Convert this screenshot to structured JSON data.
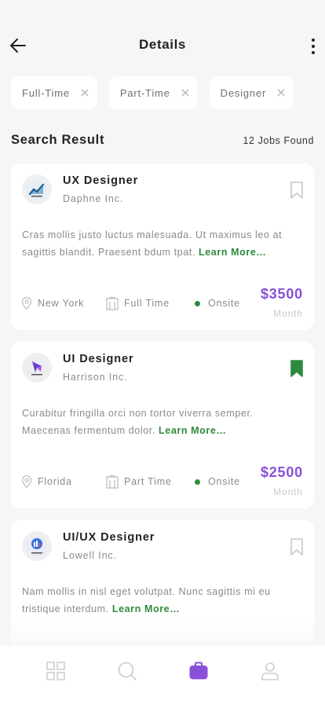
{
  "header": {
    "title": "Details"
  },
  "filters": [
    {
      "label": "Full-Time"
    },
    {
      "label": "Part-Time"
    },
    {
      "label": "Designer"
    }
  ],
  "results": {
    "title": "Search Result",
    "count_text": "12 Jobs Found"
  },
  "jobs": [
    {
      "title": "UX Designer",
      "company": "Daphne Inc.",
      "description": "Cras mollis justo luctus malesuada. Ut maximus leo at sagittis blandit. Praesent bdum tpat.",
      "learn_more": "Learn More…",
      "location": "New York",
      "type": "Full Time",
      "mode": "Onsite",
      "price": "$3500",
      "period": "Month",
      "bookmarked": false
    },
    {
      "title": "UI Designer",
      "company": "Harrison Inc.",
      "description": "Curabitur fringilla orci non tortor viverra semper. Maecenas fermentum dolor.",
      "learn_more": "Learn More…",
      "location": "Florida",
      "type": "Part Time",
      "mode": "Onsite",
      "price": "$2500",
      "period": "Month",
      "bookmarked": true
    },
    {
      "title": "UI/UX Designer",
      "company": "Lowell Inc.",
      "description": "Nam mollis in nisl eget volutpat. Nunc sagittis mi eu tristique interdum.",
      "learn_more": "Learn More…",
      "bookmarked": false
    }
  ],
  "bottom_nav": [
    {
      "icon": "grid-icon",
      "active": false
    },
    {
      "icon": "search-icon",
      "active": false
    },
    {
      "icon": "briefcase-icon",
      "active": true
    },
    {
      "icon": "profile-icon",
      "active": false
    }
  ],
  "colors": {
    "accent": "#8a4fd8",
    "green": "#2e8b3d",
    "muted": "#8a8a8a",
    "background": "#f6f6f6"
  }
}
